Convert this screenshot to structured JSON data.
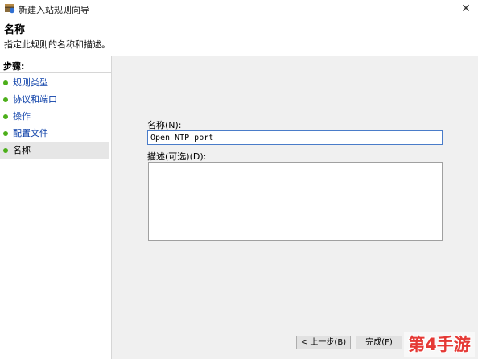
{
  "window": {
    "title": "新建入站规则向导",
    "close_label": "✕"
  },
  "header": {
    "title": "名称",
    "description": "指定此规则的名称和描述。"
  },
  "steps": {
    "title": "步骤:",
    "items": [
      {
        "label": "规则类型"
      },
      {
        "label": "协议和端口"
      },
      {
        "label": "操作"
      },
      {
        "label": "配置文件"
      },
      {
        "label": "名称",
        "active": true
      }
    ]
  },
  "form": {
    "name_label": "名称(N):",
    "name_value": "Open NTP port",
    "desc_label": "描述(可选)(D):",
    "desc_value": ""
  },
  "buttons": {
    "back": "< 上一步(B)",
    "finish": "完成(F)"
  },
  "watermark": "第4手游",
  "colors": {
    "accent": "#0078d7",
    "step_dot": "#4caf1a",
    "link": "#0b3fa8"
  }
}
